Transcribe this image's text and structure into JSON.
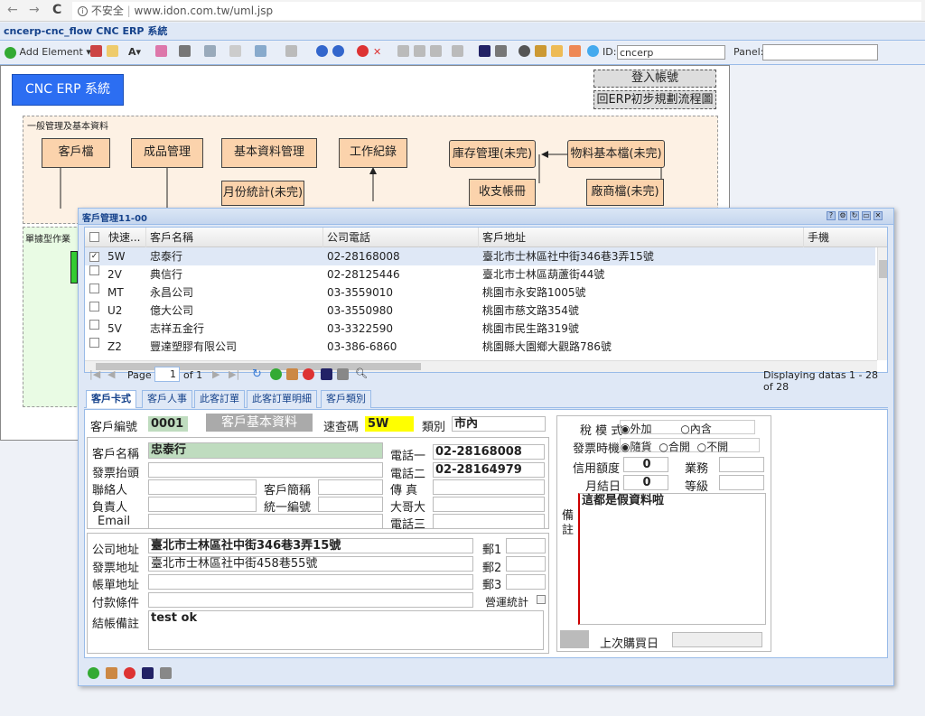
{
  "browser": {
    "back": "←",
    "fwd": "→",
    "reload": "C",
    "secure": "不安全",
    "url": "www.idon.com.tw/uml.jsp"
  },
  "app": {
    "title": "cncerp-cnc_flow CNC ERP 系統"
  },
  "toolbar": {
    "add_element": "Add Element",
    "id_label": "ID:",
    "id_value": "cncerp",
    "panel_label": "Panel:",
    "panel_value": ""
  },
  "diagram": {
    "title_box": "CNC ERP 系統",
    "login_button": "登入帳號",
    "back_button": "回ERP初步規劃流程圖",
    "group1_label": "一般管理及基本資料",
    "group2_label": "單據型作業",
    "boxes": [
      "客戶檔",
      "成品管理",
      "基本資料管理",
      "工作紀錄",
      "庫存管理(未完)",
      "物料基本檔(未完)",
      "月份統計(未完)",
      "收支帳冊",
      "廠商檔(未完)"
    ]
  },
  "window": {
    "title": "客戶管理11-00",
    "tools": [
      "?",
      "⚙",
      "↻",
      "▭",
      "✕"
    ],
    "columns": [
      "快速...",
      "客戶名稱",
      "公司電話",
      "客戶地址",
      "手機"
    ],
    "rows": [
      [
        "5W",
        "忠泰行",
        "02-28168008",
        "臺北市士林區社中街346巷3弄15號"
      ],
      [
        "2V",
        "典信行",
        "02-28125446",
        "臺北市士林區葫蘆街44號"
      ],
      [
        "MT",
        "永昌公司",
        "03-3559010",
        "桃園市永安路1005號"
      ],
      [
        "U2",
        "億大公司",
        "03-3550980",
        "桃園市慈文路354號"
      ],
      [
        "5V",
        "志祥五金行",
        "03-3322590",
        "桃園市民生路319號"
      ],
      [
        "Z2",
        "豐達塑膠有限公司",
        "03-386-6860",
        "桃園縣大園鄉大觀路786號"
      ]
    ],
    "pager": {
      "page_label": "Page",
      "page_value": "1",
      "of_label": "of 1",
      "display": "Displaying datas 1 - 28 of 28"
    },
    "tabs": [
      "客戶卡式",
      "客戶人事",
      "此客訂單",
      "此客訂單明細",
      "客戶類別"
    ],
    "form": {
      "cust_no_label": "客戶編號",
      "cust_no": "0001",
      "section_title": "客戶基本資料",
      "quick_label": "速查碼",
      "quick": "5W",
      "type_label": "類別",
      "type": "市內",
      "name_label": "客戶名稱",
      "name": "忠泰行",
      "phone1_label": "電話一",
      "phone1": "02-28168008",
      "invoice_title_label": "發票抬頭",
      "invoice_title": "",
      "phone2_label": "電話二",
      "phone2": "02-28164979",
      "contact_label": "聯絡人",
      "contact": "",
      "short_label": "客戶簡稱",
      "short": "",
      "fax_label": "傳 真",
      "fax": "",
      "owner_label": "負責人",
      "owner": "",
      "vat_label": "統一編號",
      "vat": "",
      "mobile_label": "大哥大",
      "mobile": "",
      "email_label": "Email",
      "email": "",
      "phone3_label": "電話三",
      "phone3": "",
      "addr_label": "公司地址",
      "addr": "臺北市士林區社中街346巷3弄15號",
      "zip1_label": "郵1",
      "zip1": "",
      "inv_addr_label": "發票地址",
      "inv_addr": "臺北市士林區社中街458巷55號",
      "zip2_label": "郵2",
      "zip2": "",
      "bill_addr_label": "帳單地址",
      "bill_addr": "",
      "zip3_label": "郵3",
      "zip3": "",
      "pay_label": "付款條件",
      "pay": "",
      "stat_label": "營運統計",
      "note_label": "結帳備註",
      "note": "test ok",
      "tax_label": "稅 模 式",
      "tax_opt1": "外加",
      "tax_opt2": "內含",
      "inv_time_label": "發票時機",
      "inv_opt1": "隨貨",
      "inv_opt2": "合開",
      "inv_opt3": "不開",
      "credit_label": "信用額度",
      "credit": "0",
      "sales_label": "業務",
      "sales": "",
      "close_day_label": "月結日",
      "close_day": "0",
      "grade_label": "等級",
      "grade": "",
      "remark_label": "備註",
      "remark": "這都是假資料啦",
      "last_buy_label": "上次購買日",
      "last_buy": ""
    }
  }
}
